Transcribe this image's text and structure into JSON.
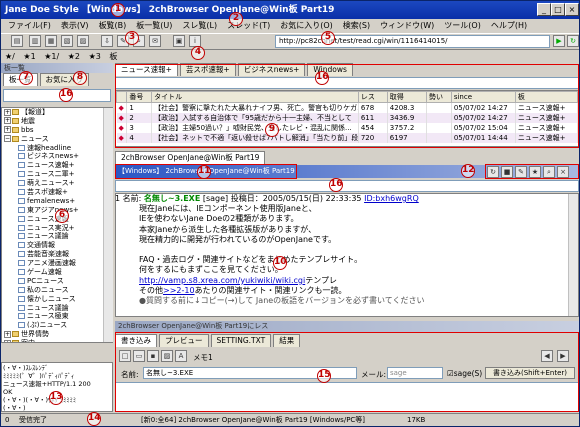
{
  "window": {
    "title": "Jane Doe Style 【Windows】 2chBrowser OpenJane@Win板 Part19"
  },
  "menu": [
    "ファイル(F)",
    "表示(V)",
    "板覧(B)",
    "板一覧(U)",
    "スレ覧(L)",
    "スレッド(T)",
    "お気に入り(O)",
    "検索(S)",
    "ウィンドウ(W)",
    "ツール(O)",
    "ヘルプ(H)"
  ],
  "address": {
    "url": "http://pc82chnet/test/read.cgi/win/1116414015/"
  },
  "bookmarks": [
    "★/",
    "★1",
    "★1/",
    "★2",
    "★3",
    "板"
  ],
  "sidebar": {
    "tabs": [
      "板一覧",
      "お気に入り"
    ],
    "items": [
      {
        "label": "【報道】",
        "type": "folder",
        "level": 0
      },
      {
        "label": "地震",
        "type": "folder",
        "level": 0
      },
      {
        "label": "bbs",
        "type": "folder",
        "level": 0
      },
      {
        "label": "ニュース",
        "type": "folder-open",
        "level": 0
      },
      {
        "label": "速報headline",
        "type": "leaf",
        "level": 1
      },
      {
        "label": "ビジネスnews+",
        "type": "leaf",
        "level": 1
      },
      {
        "label": "ニュース速報+",
        "type": "leaf",
        "level": 1
      },
      {
        "label": "ニュース二軍+",
        "type": "leaf",
        "level": 1
      },
      {
        "label": "萌えニュース+",
        "type": "leaf",
        "level": 1
      },
      {
        "label": "芸スポ速報+",
        "type": "leaf",
        "level": 1
      },
      {
        "label": "femalenews+",
        "type": "leaf",
        "level": 1
      },
      {
        "label": "東アジアnews+",
        "type": "leaf",
        "level": 1
      },
      {
        "label": "ニュース速報",
        "type": "leaf",
        "level": 1
      },
      {
        "label": "ニュース実況+",
        "type": "leaf",
        "level": 1
      },
      {
        "label": "ニュース議論",
        "type": "leaf",
        "level": 1
      },
      {
        "label": "交通情報",
        "type": "leaf",
        "level": 1
      },
      {
        "label": "芸能音楽速報",
        "type": "leaf",
        "level": 1
      },
      {
        "label": "アニメ漫画速報",
        "type": "leaf",
        "level": 1
      },
      {
        "label": "ゲーム速報",
        "type": "leaf",
        "level": 1
      },
      {
        "label": "PCニュース",
        "type": "leaf",
        "level": 1
      },
      {
        "label": "私のニュース",
        "type": "leaf",
        "level": 1
      },
      {
        "label": "懐かしニュース",
        "type": "leaf",
        "level": 1
      },
      {
        "label": "ニュース議論",
        "type": "leaf",
        "level": 1
      },
      {
        "label": "ニュース極東",
        "type": "leaf",
        "level": 1
      },
      {
        "label": "(ぷ)ニュース",
        "type": "leaf",
        "level": 1
      },
      {
        "label": "世界情勢",
        "type": "folder",
        "level": 0
      },
      {
        "label": "案内",
        "type": "folder",
        "level": 0
      }
    ],
    "aa_lines": [
      "(・∀・)ｽﾚｽﾚﾝﾃﾞ",
      "ﾐﾐﾐﾐﾐ(゜∀゜)ﾊﾟﾃﾞｨﾊﾟﾃﾞｨ",
      "ニュース速報+HTTP/1.1 200",
      "OK",
      "(・∀・)(・∀・)ｳﾎｯ ﾐﾐﾐﾐﾐ",
      "(・∀・)"
    ]
  },
  "threadlist": {
    "tabs": [
      "ニュース速報+",
      "芸スポ速報+",
      "ビジネスnews+",
      "Windows"
    ],
    "columns": [
      "",
      "番号",
      "タイトル",
      "レス",
      "取得",
      "勢い",
      "since",
      "板"
    ],
    "rows": [
      {
        "mark": "◆",
        "num": "1",
        "title": "【社会】警察に撃たれた大暴れナイフ男、死亡。警官も切りケガ…",
        "res": "678",
        "got": "4208.3",
        "force": "",
        "since": "05/07/02 14:27",
        "board": "ニュース速報+"
      },
      {
        "mark": "◆",
        "num": "2",
        "title": "【政治】入試する自治体で「95歳だから十一主婦、不当として",
        "res": "611",
        "got": "3436.9",
        "force": "",
        "since": "05/07/02 14:27",
        "board": "ニュース速報+"
      },
      {
        "mark": "◆",
        "num": "3",
        "title": "【政治】主婦50過い？」嘘財民党、先したレビ・混乱に関係...",
        "res": "454",
        "got": "3757.2",
        "force": "",
        "since": "05/07/02 15:04",
        "board": "ニュース速報+"
      },
      {
        "mark": "◆",
        "num": "4",
        "title": "【社会】ネットで不適「返い殺せば7バトし解消」「当たり前」段で...",
        "res": "720",
        "got": "6197",
        "force": "",
        "since": "05/07/01 14:44",
        "board": "ニュース速報+"
      }
    ]
  },
  "viewer": {
    "tab": "2chBrowser OpenJane@Win板 Part19",
    "header": "【Windows】 2chBrowser OpenJane@Win板 Part19",
    "post_num": "1",
    "post_name_label": "名前:",
    "post_name": "名無し~3.EXE",
    "post_meta": "[sage] 投稿日：2005/05/15(日) 22:33:35",
    "post_id": "ID:bxh6wgRQ",
    "lines": [
      "現在Janeには、IEコンポーネント使用版Janeと、",
      "IEを使わないJane Doeの2種類があります。",
      "本家Janeから派生した各種拡張版がありますが、",
      "現在精力的に開発が行われているのがOpenJaneです。",
      "",
      "FAQ・過去ログ・関連サイトなどをまとめたテンプレサイト。",
      "何をするにもまずここを見てください。"
    ],
    "link1": "http://vamp.s8.xrea.com/yukiwiki/wiki.cgi",
    "link1_after": "テンプレ",
    "link2_before": "その他",
    "link2": ">>2-10",
    "link2_after": "あたりの関連サイト・関連リンクも一読。",
    "trailing": "●質問する前に↓コピー(→)して Janeの板語をバージョンを必ず書いてください"
  },
  "writepanel": {
    "title": "2chBrowser OpenJane@Win板 Part19にレス",
    "tabs": [
      "書き込み",
      "プレビュー",
      "SETTING.TXT",
      "結果"
    ],
    "memo": "メモ1",
    "name_label": "名前:",
    "name_value": "名無し~3.EXE",
    "mail_label": "メール:",
    "mail_value": "sage",
    "sage_label": "sage(S)",
    "submit": "書き込み(Shift+Enter)"
  },
  "status": {
    "left": "0",
    "done": "受信完了",
    "center": "[新0:全64] 2chBrowser OpenJane@Win板 Part19 [Windows/PC等]",
    "size": "17KB"
  },
  "callouts": [
    "1",
    "2",
    "3",
    "4",
    "5",
    "6",
    "7",
    "8",
    "9",
    "10",
    "11",
    "12",
    "13",
    "14",
    "15",
    "16",
    "16",
    "16"
  ]
}
